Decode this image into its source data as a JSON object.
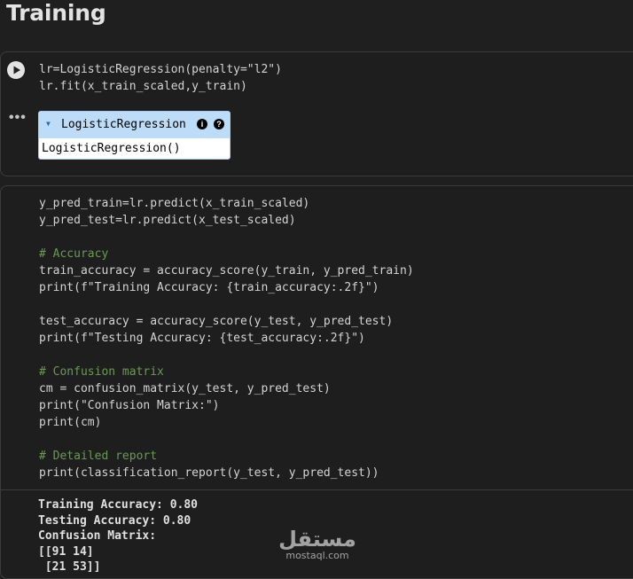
{
  "section_title": "Training",
  "cell1": {
    "lines": [
      "lr=LogisticRegression(penalty=\"l2\")",
      "lr.fit(x_train_scaled,y_train)"
    ]
  },
  "widget": {
    "title": "LogisticRegression",
    "info_icon_label": "i",
    "help_icon_label": "?",
    "body": "LogisticRegression()"
  },
  "cell2": {
    "lines": [
      "y_pred_train=lr.predict(x_train_scaled)",
      "y_pred_test=lr.predict(x_test_scaled)",
      "",
      "# Accuracy",
      "train_accuracy = accuracy_score(y_train, y_pred_train)",
      "print(f\"Training Accuracy: {train_accuracy:.2f}\")",
      "",
      "test_accuracy = accuracy_score(y_test, y_pred_test)",
      "print(f\"Testing Accuracy: {test_accuracy:.2f}\")",
      "",
      "# Confusion matrix",
      "cm = confusion_matrix(y_test, y_pred_test)",
      "print(\"Confusion Matrix:\")",
      "print(cm)",
      "",
      "# Detailed report",
      "print(classification_report(y_test, y_pred_test))"
    ]
  },
  "output": {
    "lines": [
      "Training Accuracy: 0.80",
      "Testing Accuracy: 0.80",
      "Confusion Matrix:",
      "[[91 14]",
      " [21 53]]"
    ]
  },
  "watermark": {
    "logo_text": "مستقل",
    "site": "mostaql.com"
  }
}
